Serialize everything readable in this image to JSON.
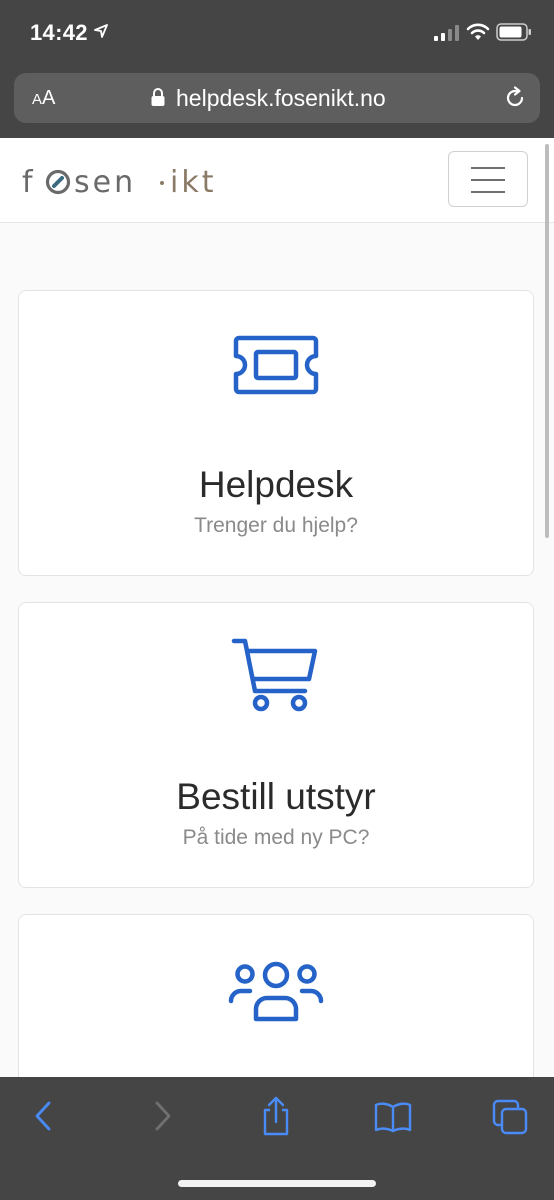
{
  "status_bar": {
    "time": "14:42"
  },
  "browser": {
    "text_size_button": {
      "small": "A",
      "large": "A"
    },
    "url": "helpdesk.fosenikt.no"
  },
  "site": {
    "logo": {
      "part1": "f",
      "part2": "sen",
      "part3": "ikt"
    },
    "cards": [
      {
        "title": "Helpdesk",
        "subtitle": "Trenger du hjelp?",
        "icon": "ticket-icon"
      },
      {
        "title": "Bestill utstyr",
        "subtitle": "På tide med ny PC?",
        "icon": "shopping-cart-icon"
      },
      {
        "title": "",
        "subtitle": "",
        "icon": "users-icon"
      }
    ]
  },
  "colors": {
    "accent_blue": "#2563c9",
    "chrome": "#454545",
    "urlbar": "#5e5e5e",
    "toolbar_icon": "#4a8cf7",
    "logo_gray": "#6a6a6a",
    "logo_teal": "#3b6b80",
    "logo_brown": "#8a7a66"
  }
}
